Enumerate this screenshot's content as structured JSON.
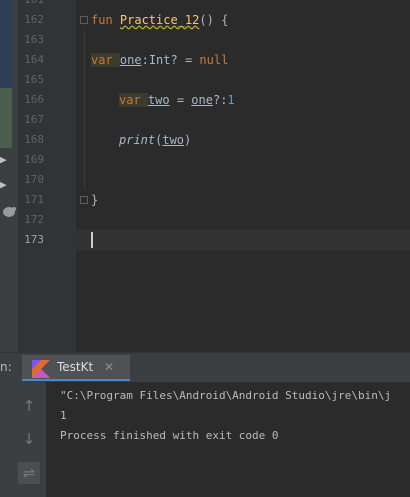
{
  "line_numbers": [
    "161",
    "162",
    "163",
    "164",
    "165",
    "166",
    "167",
    "168",
    "169",
    "170",
    "171",
    "172",
    "173"
  ],
  "current_line": "173",
  "code": {
    "line162": {
      "kw": "fun ",
      "name": "Practice_12",
      "rest": "() {"
    },
    "line164": {
      "kw": "var ",
      "var": "one",
      "rest": ":Int? = ",
      "null": "null"
    },
    "line166": {
      "kw": "var ",
      "var": "two",
      "eq": " = ",
      "ref": "one",
      "op": "?:",
      "num": "1"
    },
    "line168": {
      "fn": "print",
      "open": "(",
      "arg": "two",
      "close": ")"
    },
    "line171": {
      "text": "}"
    }
  },
  "run_panel": {
    "label": "n:",
    "tab_label": "TestKt",
    "tab_close": "✕",
    "console": [
      "\"C:\\Program Files\\Android\\Android Studio\\jre\\bin\\j",
      "1",
      "Process finished with exit code 0"
    ]
  },
  "icons": {
    "tab": "kotlin-logo-icon",
    "tools": [
      "arrow-up-icon",
      "arrow-down-icon",
      "soft-wrap-icon"
    ]
  },
  "colors": {
    "keyword": "#cc7832",
    "function": "#ffc66d",
    "number": "#6897bb",
    "text": "#a9b7c6"
  }
}
